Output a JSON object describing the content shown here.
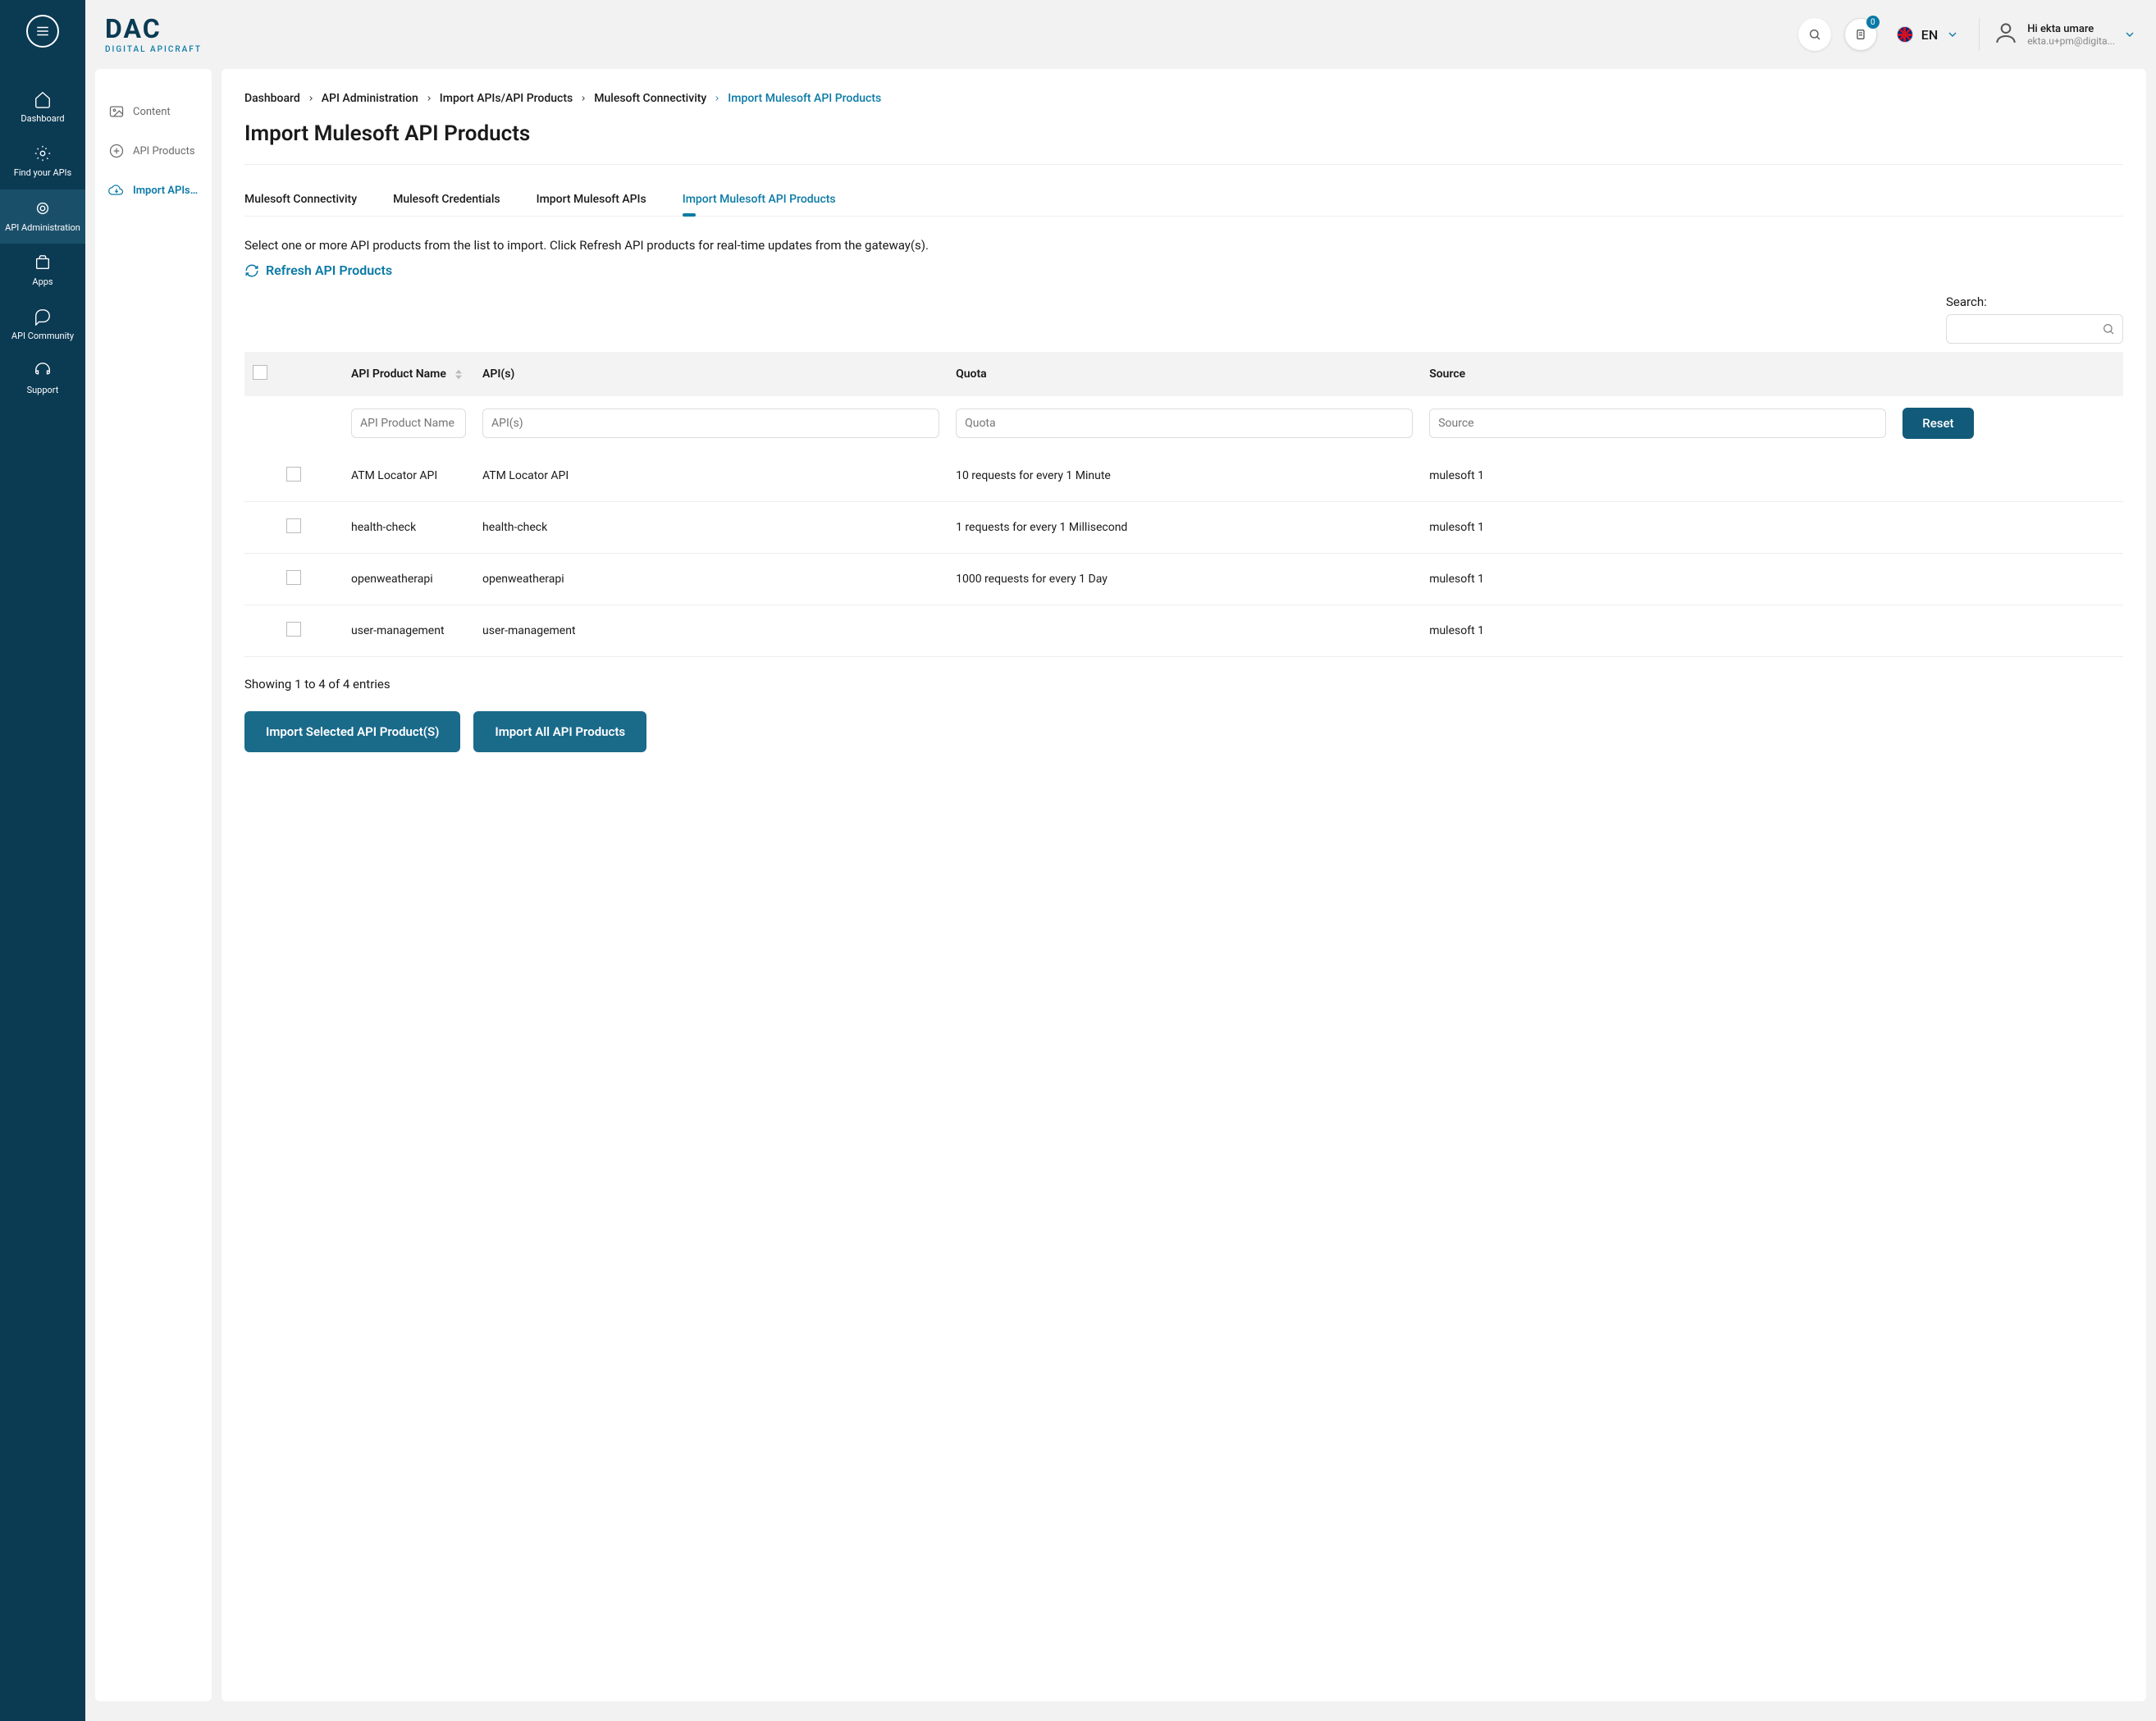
{
  "logo": {
    "main": "DAC",
    "sub": "DIGITAL APICRAFT"
  },
  "header": {
    "notif_count": "0",
    "lang_code": "EN",
    "user_greeting": "Hi ekta umare",
    "user_email": "ekta.u+pm@digita..."
  },
  "rail": [
    {
      "label": "Dashboard"
    },
    {
      "label": "Find your APIs"
    },
    {
      "label": "API Administration"
    },
    {
      "label": "Apps"
    },
    {
      "label": "API Community"
    },
    {
      "label": "Support"
    }
  ],
  "sidebar": [
    {
      "label": "Content"
    },
    {
      "label": "API Products"
    },
    {
      "label": "Import APIs / ..."
    }
  ],
  "crumbs": [
    "Dashboard",
    "API Administration",
    "Import APIs/API Products",
    "Mulesoft Connectivity",
    "Import Mulesoft API Products"
  ],
  "page_title": "Import Mulesoft API Products",
  "tabs": [
    "Mulesoft Connectivity",
    "Mulesoft Credentials",
    "Import Mulesoft APIs",
    "Import Mulesoft API Products"
  ],
  "description": "Select one or more API products from the list to import. Click Refresh API products for real-time updates from the gateway(s).",
  "refresh_label": "Refresh API Products",
  "search_label": "Search:",
  "columns": {
    "name": "API Product Name",
    "apis": "API(s)",
    "quota": "Quota",
    "source": "Source"
  },
  "filters": {
    "name": "API Product Name",
    "apis": "API(s)",
    "quota": "Quota",
    "source": "Source",
    "reset": "Reset"
  },
  "rows": [
    {
      "name": "ATM Locator API",
      "apis": "ATM Locator API",
      "quota": "10 requests for every 1 Minute",
      "source": "mulesoft 1"
    },
    {
      "name": "health-check",
      "apis": "health-check",
      "quota": "1 requests for every 1 Millisecond",
      "source": "mulesoft 1"
    },
    {
      "name": "openweatherapi",
      "apis": "openweatherapi",
      "quota": "1000 requests for every 1 Day",
      "source": "mulesoft 1"
    },
    {
      "name": "user-management",
      "apis": "user-management",
      "quota": "",
      "source": "mulesoft 1"
    }
  ],
  "footer_text": "Showing 1 to 4 of 4 entries",
  "actions": {
    "import_selected": "Import Selected API Product(S)",
    "import_all": "Import All API Products"
  }
}
